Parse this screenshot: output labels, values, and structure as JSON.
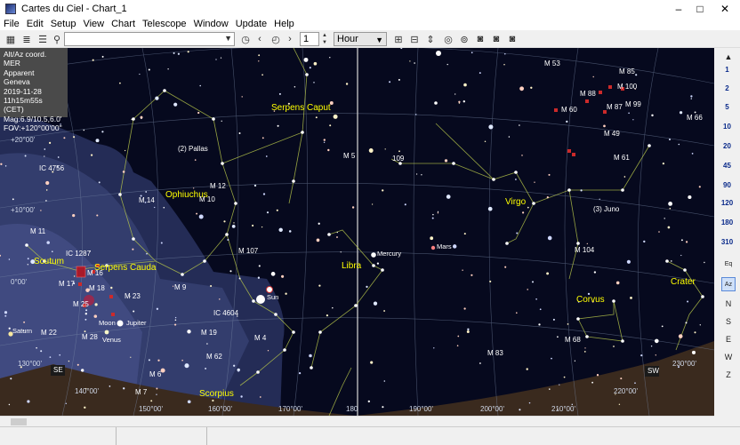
{
  "window": {
    "title": "Cartes du Ciel - Chart_1",
    "minimize": "–",
    "maximize": "□",
    "close": "✕"
  },
  "menu": [
    "File",
    "Edit",
    "Setup",
    "View",
    "Chart",
    "Telescope",
    "Window",
    "Update",
    "Help"
  ],
  "toolbar": {
    "search_value": "",
    "step_value": "1",
    "time_unit": "Hour"
  },
  "info": [
    "Alt/Az coord. MER",
    "Apparent",
    "Geneva",
    "2019-11-28",
    "11h15m55s (CET)",
    "Mag:6.9/10.5,6.0'",
    "FOV:+120°00'00\""
  ],
  "fov_buttons": [
    "1",
    "2",
    "5",
    "10",
    "20",
    "45",
    "90",
    "120",
    "180",
    "310"
  ],
  "right_buttons": [
    "Eq",
    "Az",
    "N",
    "S",
    "E",
    "W",
    "Z"
  ],
  "constellations": [
    {
      "name": "Serpens Caput",
      "color": "#ffff00"
    },
    {
      "name": "Ophiuchus",
      "color": "#ffff00"
    },
    {
      "name": "Serpens Cauda",
      "color": "#ffff00"
    },
    {
      "name": "Scutum",
      "color": "#ffff00"
    },
    {
      "name": "Libra",
      "color": "#ffff00"
    },
    {
      "name": "Virgo",
      "color": "#ffff00"
    },
    {
      "name": "Corvus",
      "color": "#ffff00"
    },
    {
      "name": "Crater",
      "color": "#ffff00"
    },
    {
      "name": "Scorpius",
      "color": "#ffff00"
    }
  ],
  "objects": [
    "M 53",
    "M 85",
    "M 88",
    "M 100",
    "M 87",
    "M 99",
    "M 60",
    "M 66",
    "M 49",
    "M 61",
    "M 5",
    "M 12",
    "M 14",
    "M 10",
    "M 107",
    "IC 4756",
    "IC 1287",
    "M 11",
    "M 16",
    "M 17",
    "M 18",
    "M 23",
    "M 9",
    "M 25",
    "M 22",
    "M 28",
    "IC 4604",
    "M 19",
    "M 62",
    "M 4",
    "M 6",
    "M 7",
    "M 104",
    "M 68",
    "M 83",
    "(2) Pallas",
    "(3) Juno",
    "109"
  ],
  "bodies": [
    "Mercury",
    "Mars",
    "Jupiter",
    "Moon",
    "Venus",
    "Saturn",
    "Sun"
  ],
  "coord_labels": [
    "+30°00'",
    "+20°00'",
    "+10°00'",
    "0°00'",
    "130°00'",
    "140°00'",
    "150°00'",
    "160°00'",
    "170°00'",
    "180",
    "190°00'",
    "200°00'",
    "210°00'",
    "220°00'",
    "230°00'"
  ],
  "horizon_labels": [
    "SE",
    "SW"
  ]
}
